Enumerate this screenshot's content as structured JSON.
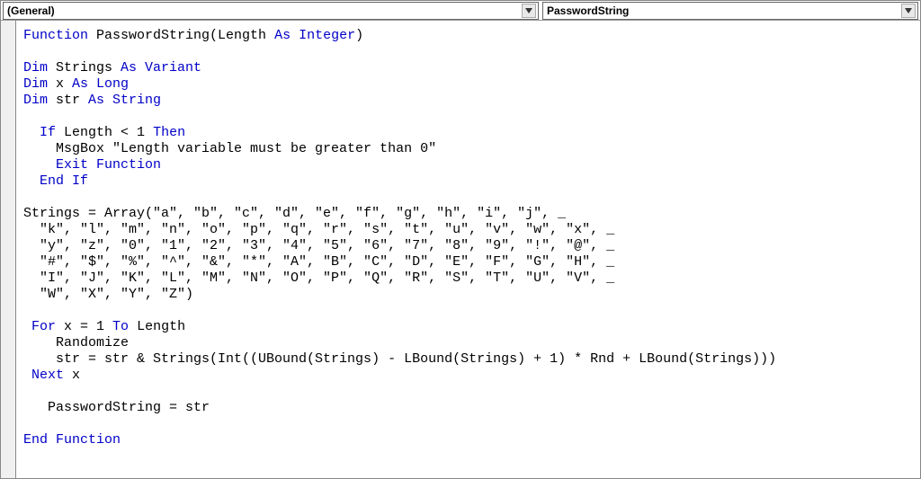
{
  "dropdowns": {
    "left": "(General)",
    "right": "PasswordString"
  },
  "code": {
    "tokens": [
      [
        [
          "kw",
          "Function"
        ],
        [
          "txt",
          " PasswordString(Length "
        ],
        [
          "kw",
          "As Integer"
        ],
        [
          "txt",
          ")"
        ]
      ],
      [],
      [
        [
          "kw",
          "Dim"
        ],
        [
          "txt",
          " Strings "
        ],
        [
          "kw",
          "As Variant"
        ]
      ],
      [
        [
          "kw",
          "Dim"
        ],
        [
          "txt",
          " x "
        ],
        [
          "kw",
          "As Long"
        ]
      ],
      [
        [
          "kw",
          "Dim"
        ],
        [
          "txt",
          " str "
        ],
        [
          "kw",
          "As String"
        ]
      ],
      [],
      [
        [
          "txt",
          "  "
        ],
        [
          "kw",
          "If"
        ],
        [
          "txt",
          " Length < 1 "
        ],
        [
          "kw",
          "Then"
        ]
      ],
      [
        [
          "txt",
          "    MsgBox \"Length variable must be greater than 0\""
        ]
      ],
      [
        [
          "txt",
          "    "
        ],
        [
          "kw",
          "Exit Function"
        ]
      ],
      [
        [
          "txt",
          "  "
        ],
        [
          "kw",
          "End If"
        ]
      ],
      [],
      [
        [
          "txt",
          "Strings = Array(\"a\", \"b\", \"c\", \"d\", \"e\", \"f\", \"g\", \"h\", \"i\", \"j\", _"
        ]
      ],
      [
        [
          "txt",
          "  \"k\", \"l\", \"m\", \"n\", \"o\", \"p\", \"q\", \"r\", \"s\", \"t\", \"u\", \"v\", \"w\", \"x\", _"
        ]
      ],
      [
        [
          "txt",
          "  \"y\", \"z\", \"0\", \"1\", \"2\", \"3\", \"4\", \"5\", \"6\", \"7\", \"8\", \"9\", \"!\", \"@\", _"
        ]
      ],
      [
        [
          "txt",
          "  \"#\", \"$\", \"%\", \"^\", \"&\", \"*\", \"A\", \"B\", \"C\", \"D\", \"E\", \"F\", \"G\", \"H\", _"
        ]
      ],
      [
        [
          "txt",
          "  \"I\", \"J\", \"K\", \"L\", \"M\", \"N\", \"O\", \"P\", \"Q\", \"R\", \"S\", \"T\", \"U\", \"V\", _"
        ]
      ],
      [
        [
          "txt",
          "  \"W\", \"X\", \"Y\", \"Z\")"
        ]
      ],
      [],
      [
        [
          "txt",
          " "
        ],
        [
          "kw",
          "For"
        ],
        [
          "txt",
          " x = 1 "
        ],
        [
          "kw",
          "To"
        ],
        [
          "txt",
          " Length"
        ]
      ],
      [
        [
          "txt",
          "    Randomize"
        ]
      ],
      [
        [
          "txt",
          "    str = str & Strings(Int((UBound(Strings) - LBound(Strings) + 1) * Rnd + LBound(Strings)))"
        ]
      ],
      [
        [
          "txt",
          " "
        ],
        [
          "kw",
          "Next"
        ],
        [
          "txt",
          " x"
        ]
      ],
      [],
      [
        [
          "txt",
          "   PasswordString = str"
        ]
      ],
      [],
      [
        [
          "kw",
          "End Function"
        ]
      ]
    ]
  }
}
